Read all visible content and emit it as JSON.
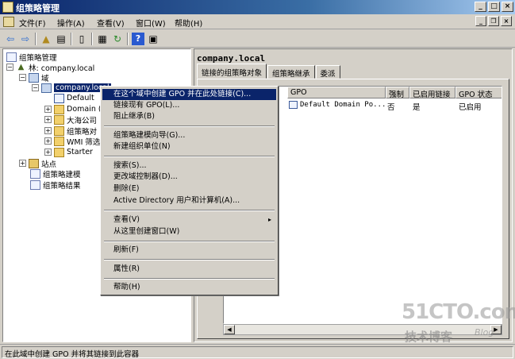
{
  "window": {
    "title": "组策略管理",
    "min": "_",
    "max": "□",
    "close": "×"
  },
  "menubar": {
    "items": [
      "文件(F)",
      "操作(A)",
      "查看(V)",
      "窗口(W)",
      "帮助(H)"
    ],
    "mdi": {
      "min": "_",
      "restore": "❐",
      "close": "×"
    }
  },
  "toolbar": [
    "back-arrow-icon",
    "forward-arrow-icon",
    "up-folder-icon",
    "show-tree-icon",
    "copy-icon",
    "properties-icon",
    "refresh-icon",
    "help-icon",
    "console-icon"
  ],
  "tree": {
    "root": "组策略管理",
    "forest": "林: company.local",
    "domains": "域",
    "domain": "company.local",
    "children": [
      "Default",
      "Domain (",
      "大海公司",
      "组策略对",
      "WMI 筛选",
      "Starter"
    ],
    "sites": "站点",
    "modeling": "组策略建模",
    "results": "组策略结果"
  },
  "right": {
    "title": "company.local",
    "tabs": [
      "链接的组策略对象",
      "组策略继承",
      "委派"
    ],
    "columns": [
      "GPO",
      "强制",
      "已启用链接",
      "GPO 状态"
    ],
    "rows": [
      {
        "gpo": "Default Domain Po...",
        "enforced": "否",
        "link_enabled": "是",
        "status": "已启用"
      }
    ]
  },
  "context_menu": {
    "items": [
      "在这个域中创建 GPO 并在此处链接(C)...",
      "链接现有 GPO(L)...",
      "阻止继承(B)",
      "组策略建模向导(G)...",
      "新建组织单位(N)",
      "搜索(S)...",
      "更改域控制器(D)...",
      "删除(E)",
      "Active Directory 用户和计算机(A)...",
      "查看(V)",
      "从这里创建窗口(W)",
      "刷新(F)",
      "属性(R)",
      "帮助(H)"
    ],
    "submenu_arrow": "▸"
  },
  "status": "在此域中创建 GPO 并将其链接到此容器",
  "watermark": {
    "site": "51CTO.com",
    "cn": "技术博客",
    "blog": "Blog"
  }
}
